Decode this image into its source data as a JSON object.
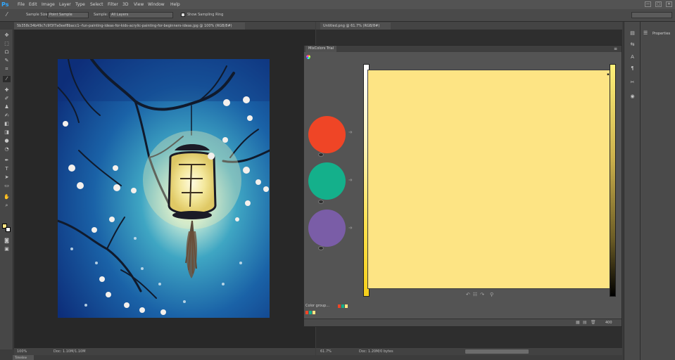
{
  "app": {
    "logo": "Ps",
    "accent": "#31a8ff"
  },
  "menu": [
    "File",
    "Edit",
    "Image",
    "Layer",
    "Type",
    "Select",
    "Filter",
    "3D",
    "View",
    "Window",
    "Help"
  ],
  "window_controls": [
    "—",
    "□",
    "✕"
  ],
  "options_bar": {
    "sample_size_label": "Sample Size:",
    "sample_size_value": "Point Sample",
    "sample_label": "Sample:",
    "sample_value": "All Layers",
    "show_ring_label": "Show Sampling Ring"
  },
  "right_dropdown": "",
  "tabs": {
    "doc1": "5b358c34b49c7c9f3f7a0eef8bacc1--fun-painting-ideas-for-kids-acrylic-painting-for-beginners-ideas.jpg @ 100% (RGB/8#)",
    "doc2": "Untitled.png @ 61.7% (RGB/8#)"
  },
  "status": {
    "zoom1": "100%",
    "doc1": "Doc: 1.10M/1.10M",
    "zoom2": "61.7%",
    "doc2": "Doc: 1.20M/0 bytes",
    "bottom_tab": "Timeline"
  },
  "mc_panel": {
    "title": "MixColors Trial",
    "link_text": "",
    "color_group_label": "Color group...",
    "swatches": [
      {
        "name": "red",
        "color": "#ef4526"
      },
      {
        "name": "teal",
        "color": "#14b08b"
      },
      {
        "name": "purple",
        "color": "#7a5da7"
      }
    ],
    "main_color": "#fde484",
    "toolbar_icons": [
      "↶",
      "☷",
      "↷",
      "",
      "⚲"
    ],
    "footer_icons": [
      "▦",
      "▤",
      "🗑"
    ],
    "zoom_label": "400"
  },
  "right_panel": {
    "properties_label": "Properties"
  }
}
